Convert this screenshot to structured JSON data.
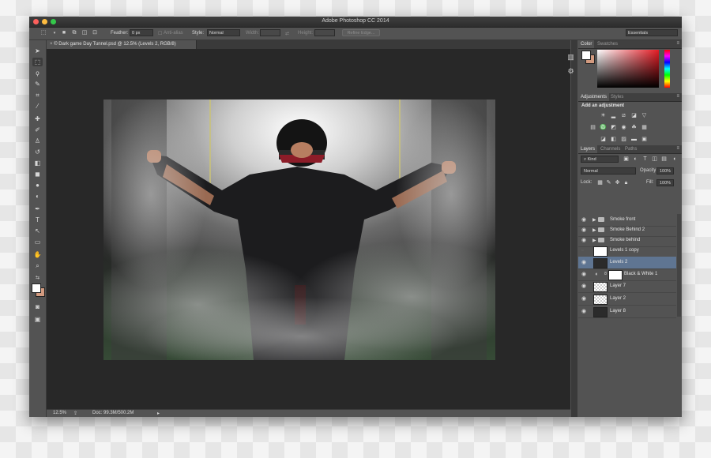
{
  "window": {
    "title": "Adobe Photoshop CC 2014"
  },
  "options": {
    "feather_label": "Feather:",
    "feather_value": "0 px",
    "antialias_label": "Anti-alias",
    "style_label": "Style:",
    "style_value": "Normal",
    "width_label": "Width:",
    "height_label": "Height:",
    "refine_edge": "Refine Edge...",
    "workspace": "Essentials"
  },
  "document": {
    "tab": "© Dark game Day Tunnel.psd @ 12.5% (Levels 2, RGB/8)"
  },
  "status": {
    "zoom": "12.5%",
    "doc": "Doc: 99.3M/500.2M"
  },
  "panels": {
    "color_tabs": [
      "Color",
      "Swatches"
    ],
    "adjust_tabs": [
      "Adjustments",
      "Styles"
    ],
    "add_adjustment": "Add an adjustment",
    "layers_tabs": [
      "Layers",
      "Channels",
      "Paths"
    ],
    "kind_filter": "Kind",
    "blend_mode": "Normal",
    "opacity_label": "Opacity:",
    "opacity_value": "100%",
    "lock_label": "Lock:",
    "fill_label": "Fill:",
    "fill_value": "100%"
  },
  "layers": [
    {
      "name": "Smoke front"
    },
    {
      "name": "Smoke Behind 2"
    },
    {
      "name": "Smoke behind"
    },
    {
      "name": "Levels 1 copy"
    },
    {
      "name": "Levels 2"
    },
    {
      "name": "Black & White 1"
    },
    {
      "name": "Layer 7"
    },
    {
      "name": "Layer 2"
    },
    {
      "name": "Layer 8"
    }
  ],
  "colors": {
    "foreground": "#ffffff",
    "background": "#d39b80",
    "selected_layer": "#5f7592"
  }
}
